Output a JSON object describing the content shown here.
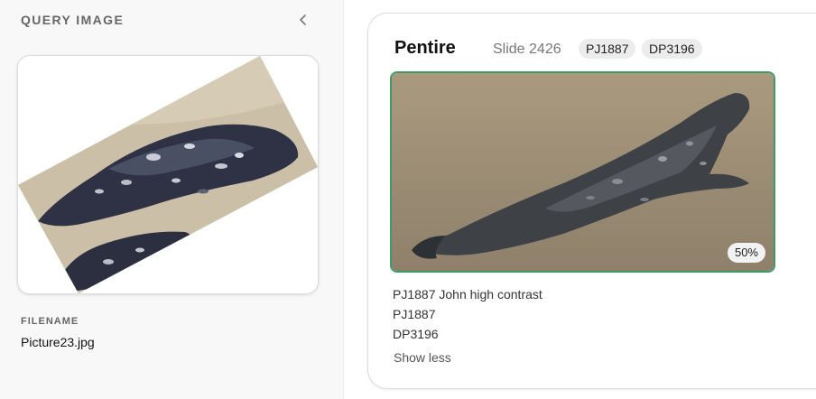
{
  "query_panel": {
    "title": "QUERY IMAGE",
    "collapse_icon": "chevron-left-icon",
    "filename_label": "FILENAME",
    "filename": "Picture23.jpg"
  },
  "match": {
    "name": "Pentire",
    "slide": "Slide 2426",
    "tags": [
      "PJ1887",
      "DP3196"
    ],
    "zoom": "50%",
    "details": [
      "PJ1887 John high contrast",
      "PJ1887",
      "DP3196"
    ],
    "show_less_label": "Show less",
    "highlight_color": "#3f9a66"
  }
}
